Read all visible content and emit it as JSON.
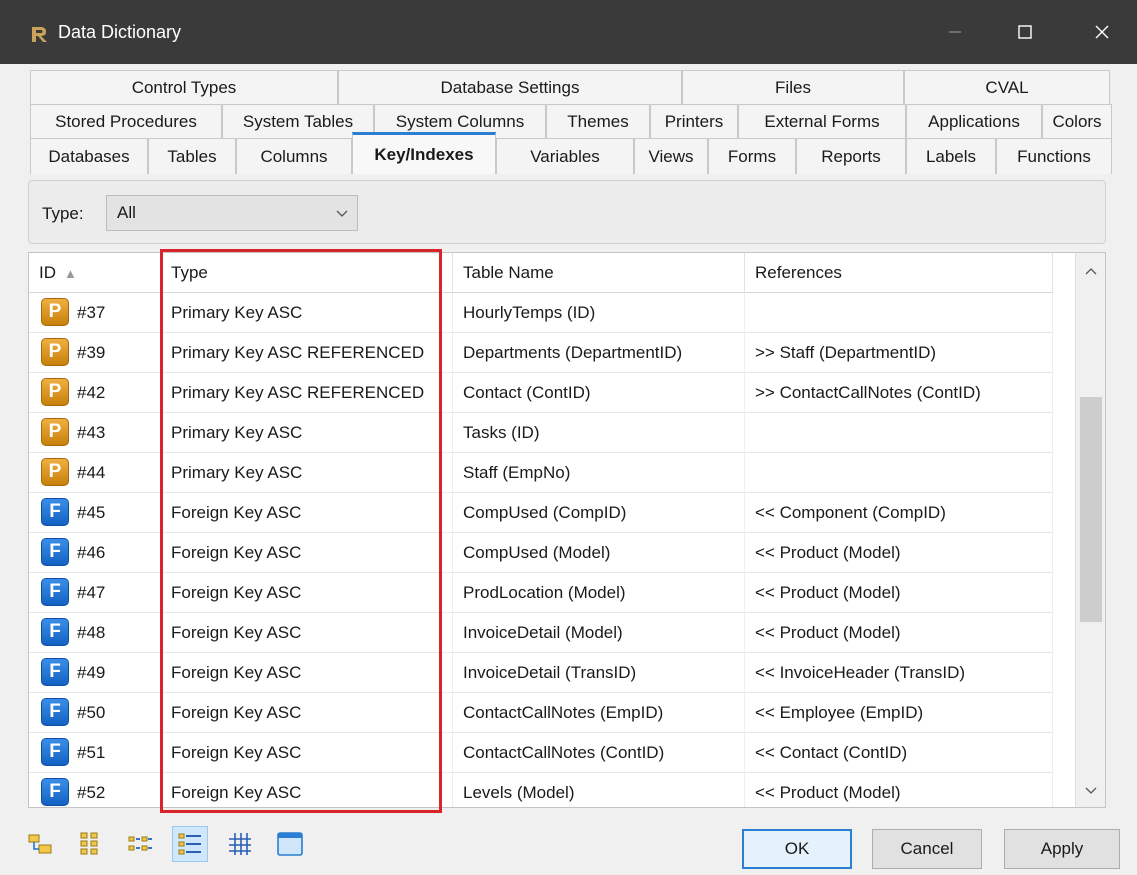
{
  "window": {
    "title": "Data Dictionary",
    "minimize_label": "—",
    "maximize_label": "☐",
    "close_label": "✕"
  },
  "tab_rows": [
    [
      "Control Types",
      "Database Settings",
      "Files",
      "CVAL"
    ],
    [
      "Stored Procedures",
      "System Tables",
      "System Columns",
      "Themes",
      "Printers",
      "External Forms",
      "Applications",
      "Colors"
    ],
    [
      "Databases",
      "Tables",
      "Columns",
      "Key/Indexes",
      "Variables",
      "Views",
      "Forms",
      "Reports",
      "Labels",
      "Functions"
    ]
  ],
  "active_tab": "Key/Indexes",
  "filter": {
    "label": "Type:",
    "value": "All"
  },
  "table": {
    "columns": [
      "ID",
      "Type",
      "Table Name",
      "References"
    ],
    "sort_indicator": "▲",
    "rows": [
      {
        "kind": "P",
        "id": "#37",
        "type": "Primary Key ASC",
        "table": "HourlyTemps (ID)",
        "references": ""
      },
      {
        "kind": "P",
        "id": "#39",
        "type": "Primary Key ASC REFERENCED",
        "table": "Departments (DepartmentID)",
        "references": ">> Staff (DepartmentID)"
      },
      {
        "kind": "P",
        "id": "#42",
        "type": "Primary Key ASC REFERENCED",
        "table": "Contact (ContID)",
        "references": ">> ContactCallNotes (ContID)"
      },
      {
        "kind": "P",
        "id": "#43",
        "type": "Primary Key ASC",
        "table": "Tasks (ID)",
        "references": ""
      },
      {
        "kind": "P",
        "id": "#44",
        "type": "Primary Key ASC",
        "table": "Staff (EmpNo)",
        "references": ""
      },
      {
        "kind": "F",
        "id": "#45",
        "type": "Foreign Key ASC",
        "table": "CompUsed (CompID)",
        "references": "<< Component (CompID)"
      },
      {
        "kind": "F",
        "id": "#46",
        "type": "Foreign Key ASC",
        "table": "CompUsed (Model)",
        "references": "<< Product (Model)"
      },
      {
        "kind": "F",
        "id": "#47",
        "type": "Foreign Key ASC",
        "table": "ProdLocation (Model)",
        "references": "<< Product (Model)"
      },
      {
        "kind": "F",
        "id": "#48",
        "type": "Foreign Key ASC",
        "table": "InvoiceDetail (Model)",
        "references": "<< Product (Model)"
      },
      {
        "kind": "F",
        "id": "#49",
        "type": "Foreign Key ASC",
        "table": "InvoiceDetail (TransID)",
        "references": "<< InvoiceHeader (TransID)"
      },
      {
        "kind": "F",
        "id": "#50",
        "type": "Foreign Key ASC",
        "table": "ContactCallNotes (EmpID)",
        "references": "<< Employee (EmpID)"
      },
      {
        "kind": "F",
        "id": "#51",
        "type": "Foreign Key ASC",
        "table": "ContactCallNotes (ContID)",
        "references": "<< Contact (ContID)"
      },
      {
        "kind": "F",
        "id": "#52",
        "type": "Foreign Key ASC",
        "table": "Levels (Model)",
        "references": "<< Product (Model)"
      }
    ]
  },
  "toolbar_icons": [
    "tree-view-icon",
    "large-icons-icon",
    "small-icons-icon",
    "list-view-icon",
    "grid-view-icon",
    "window-icon"
  ],
  "buttons": {
    "ok": "OK",
    "cancel": "Cancel",
    "apply": "Apply"
  },
  "colors": {
    "title_bar": "#3a3a3a",
    "highlight": "#d9242b",
    "active_tab_accent": "#2a7fd4",
    "primary_badge": "#e0991f",
    "foreign_badge": "#1e74d6"
  }
}
